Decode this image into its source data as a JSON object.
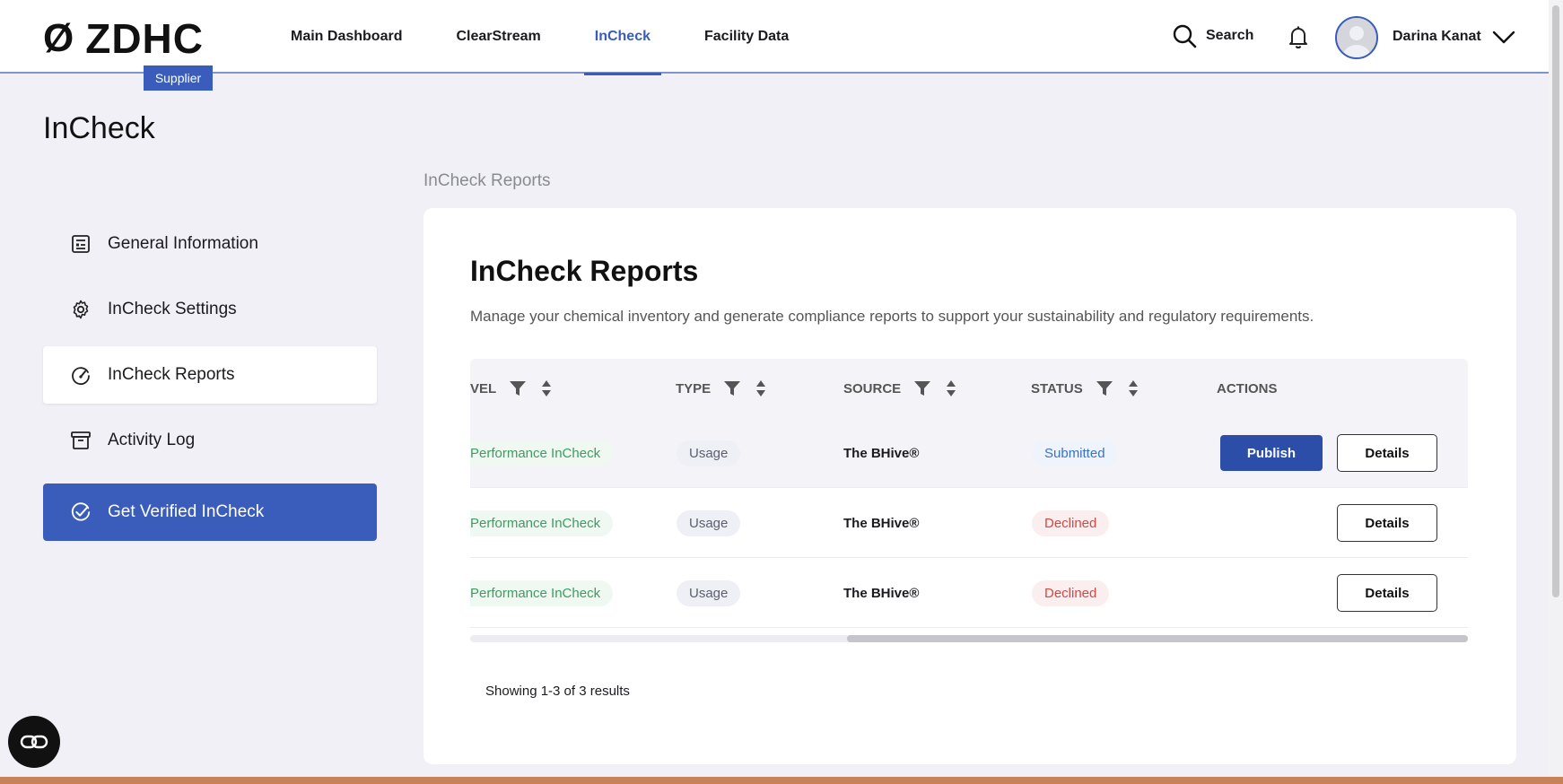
{
  "brand": {
    "logo_text": "ZDHC",
    "logo_mark": "Ø",
    "badge": "Supplier"
  },
  "nav": {
    "items": [
      {
        "label": "Main Dashboard"
      },
      {
        "label": "ClearStream"
      },
      {
        "label": "InCheck",
        "active": true
      },
      {
        "label": "Facility Data"
      }
    ]
  },
  "header": {
    "search_label": "Search",
    "user_name": "Darina Kanat",
    "icons": [
      "search-icon",
      "bell-icon",
      "avatar",
      "chevron-down-icon"
    ]
  },
  "page": {
    "title": "InCheck",
    "breadcrumb": "InCheck Reports"
  },
  "sidebar": {
    "items": [
      {
        "label": "General Information",
        "icon": "document-icon"
      },
      {
        "label": "InCheck Settings",
        "icon": "gear-icon"
      },
      {
        "label": "InCheck Reports",
        "icon": "gauge-icon",
        "selected": true
      },
      {
        "label": "Activity Log",
        "icon": "archive-icon"
      },
      {
        "label": "Get Verified InCheck",
        "icon": "check-circle-icon",
        "primary": true
      }
    ]
  },
  "card": {
    "title": "InCheck Reports",
    "description": "Manage your chemical inventory and generate compliance reports to support your sustainability and regulatory requirements."
  },
  "table": {
    "columns": {
      "level": "VEL",
      "type": "TYPE",
      "source": "SOURCE",
      "status": "STATUS",
      "actions": "ACTIONS"
    },
    "rows": [
      {
        "level": "Performance InCheck",
        "type": "Usage",
        "source": "The BHive®",
        "status": "Submitted",
        "status_color": "#3a72c8",
        "publish": "Publish",
        "details": "Details"
      },
      {
        "level": "Performance InCheck",
        "type": "Usage",
        "source": "The BHive®",
        "status": "Declined",
        "status_color": "#d04848",
        "details": "Details"
      },
      {
        "level": "Performance InCheck",
        "type": "Usage",
        "source": "The BHive®",
        "status": "Declined",
        "status_color": "#d04848",
        "details": "Details"
      }
    ],
    "results_text": "Showing 1-3 of 3 results"
  },
  "colors": {
    "accent": "#3a5cba",
    "submitted": "#3a72c8",
    "declined": "#d04848",
    "level": "#3f9a63"
  }
}
